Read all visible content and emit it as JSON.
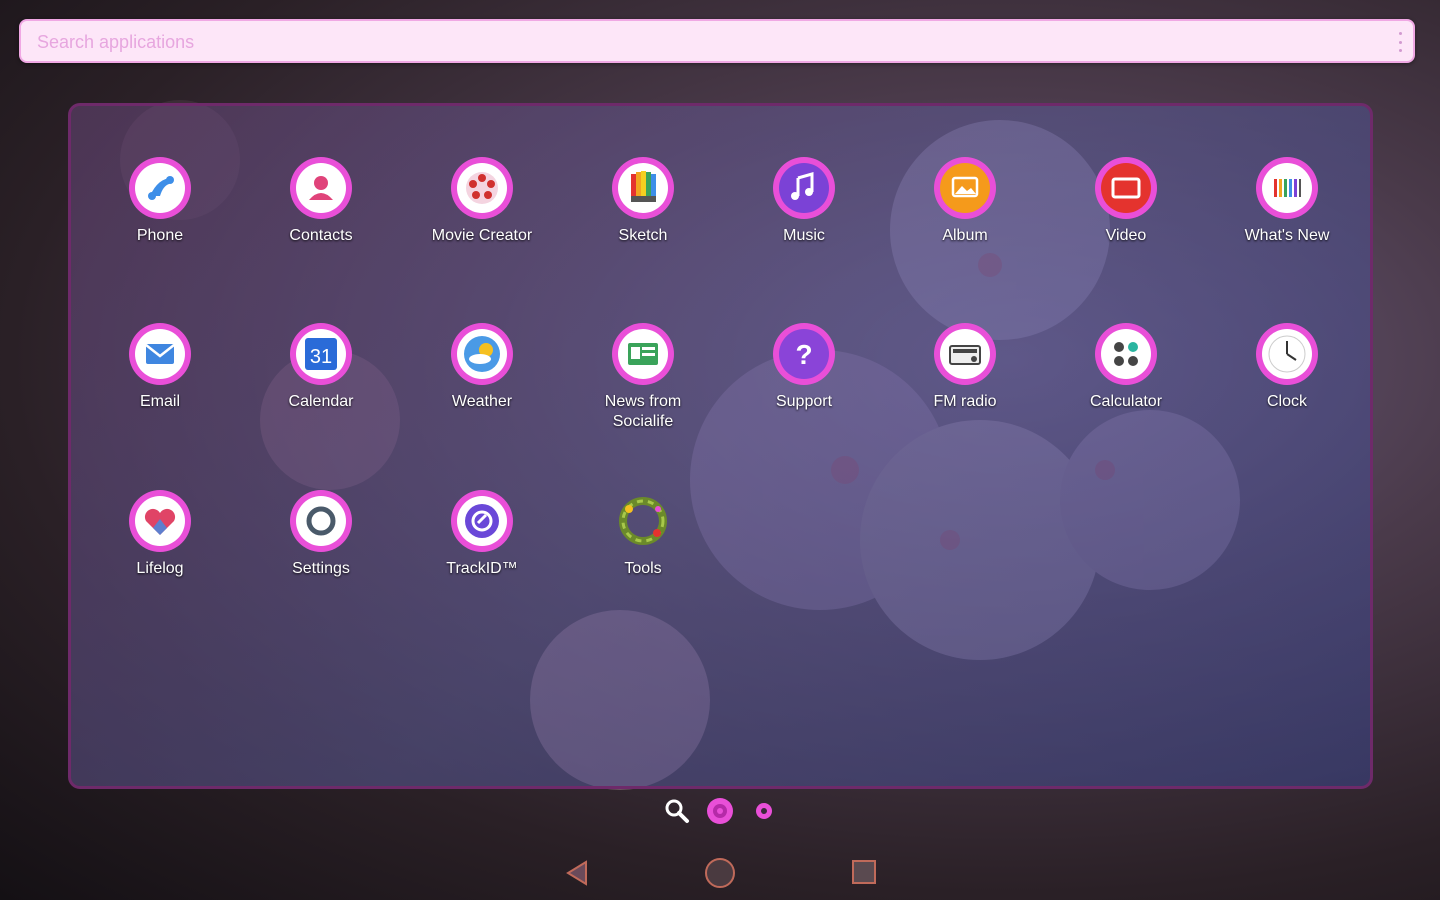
{
  "search": {
    "placeholder": "Search applications"
  },
  "colors": {
    "accent": "#e94fd8",
    "badge_bg": "#ffffff",
    "panel_border": "#6e2a6a",
    "search_bg": "#fde6f8"
  },
  "apps": [
    {
      "label": "Phone",
      "icon": "phone-icon",
      "color": "#3d8ee8"
    },
    {
      "label": "Contacts",
      "icon": "contacts-icon",
      "color": "#e0437a"
    },
    {
      "label": "Movie Creator",
      "icon": "movie-creator-icon",
      "color": "#d0302e"
    },
    {
      "label": "Sketch",
      "icon": "sketch-icon",
      "color": "#f2a520"
    },
    {
      "label": "Music",
      "icon": "music-icon",
      "color": "#7b42d6"
    },
    {
      "label": "Album",
      "icon": "album-icon",
      "color": "#f59a1b"
    },
    {
      "label": "Video",
      "icon": "video-icon",
      "color": "#e4332e"
    },
    {
      "label": "What's New",
      "icon": "whats-new-icon",
      "color": "#555555"
    },
    {
      "label": "Email",
      "icon": "email-icon",
      "color": "#3f86e0"
    },
    {
      "label": "Calendar",
      "icon": "calendar-icon",
      "color": "#2a6bd8"
    },
    {
      "label": "Weather",
      "icon": "weather-icon",
      "color": "#4a9ae6"
    },
    {
      "label": "News from\nSocialife",
      "icon": "news-icon",
      "color": "#3aa35a"
    },
    {
      "label": "Support",
      "icon": "support-icon",
      "color": "#8a44d8"
    },
    {
      "label": "FM radio",
      "icon": "fm-radio-icon",
      "color": "#444444"
    },
    {
      "label": "Calculator",
      "icon": "calculator-icon",
      "color": "#454545"
    },
    {
      "label": "Clock",
      "icon": "clock-icon",
      "color": "#333333"
    },
    {
      "label": "Lifelog",
      "icon": "lifelog-icon",
      "color": "#e04466"
    },
    {
      "label": "Settings",
      "icon": "settings-icon",
      "color": "#4a5a6a"
    },
    {
      "label": "TrackID™",
      "icon": "trackid-icon",
      "color": "#6a48d8"
    },
    {
      "label": "Tools",
      "icon": "tools-folder-icon",
      "color": "#7aa23a"
    }
  ],
  "calendar_day": "31",
  "dock": [
    "search-icon",
    "flower-icon",
    "small-flower-icon"
  ],
  "nav": [
    "back-button",
    "home-button",
    "recents-button"
  ]
}
